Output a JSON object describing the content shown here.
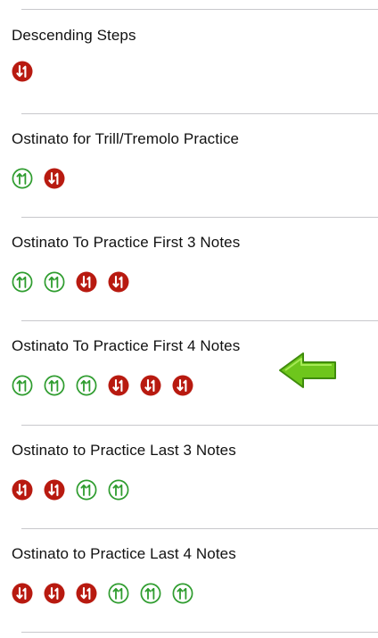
{
  "exercises": [
    {
      "title": "Descending Steps",
      "pattern": [
        "down"
      ]
    },
    {
      "title": "Ostinato for Trill/Tremolo Practice",
      "pattern": [
        "up",
        "down"
      ]
    },
    {
      "title": "Ostinato To Practice First 3 Notes",
      "pattern": [
        "up",
        "up",
        "down",
        "down"
      ]
    },
    {
      "title": "Ostinato To Practice First 4 Notes",
      "pattern": [
        "up",
        "up",
        "up",
        "down",
        "down",
        "down"
      ]
    },
    {
      "title": "Ostinato to Practice Last 3 Notes",
      "pattern": [
        "down",
        "down",
        "up",
        "up"
      ]
    },
    {
      "title": "Ostinato to Practice Last 4 Notes",
      "pattern": [
        "down",
        "down",
        "down",
        "up",
        "up",
        "up"
      ]
    }
  ],
  "icons": {
    "up": {
      "name": "ascending-step-icon",
      "color": "#2e9c2e"
    },
    "down": {
      "name": "descending-step-icon",
      "color": "#b81a10"
    }
  },
  "annotation": {
    "icon": "green-left-arrow-icon",
    "color": "#6ec61c",
    "points_to": "Ostinato To Practice First 4 Notes"
  }
}
